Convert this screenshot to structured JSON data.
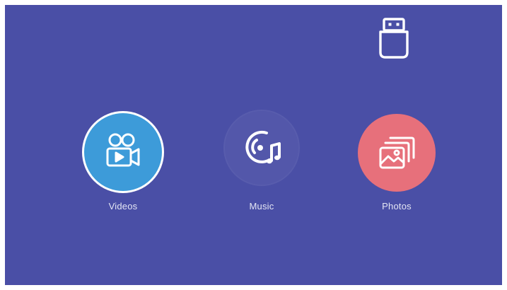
{
  "screen": {
    "background_color": "#4a4fa6",
    "source_icon": "usb-drive-icon"
  },
  "menu": {
    "items": [
      {
        "label": "Videos",
        "icon": "video-camera-icon",
        "color": "#3d9bd9",
        "selected": true
      },
      {
        "label": "Music",
        "icon": "music-disc-icon",
        "color": "#4a4fa6",
        "selected": false
      },
      {
        "label": "Photos",
        "icon": "photos-icon",
        "color": "#e7707b",
        "selected": false
      }
    ]
  }
}
